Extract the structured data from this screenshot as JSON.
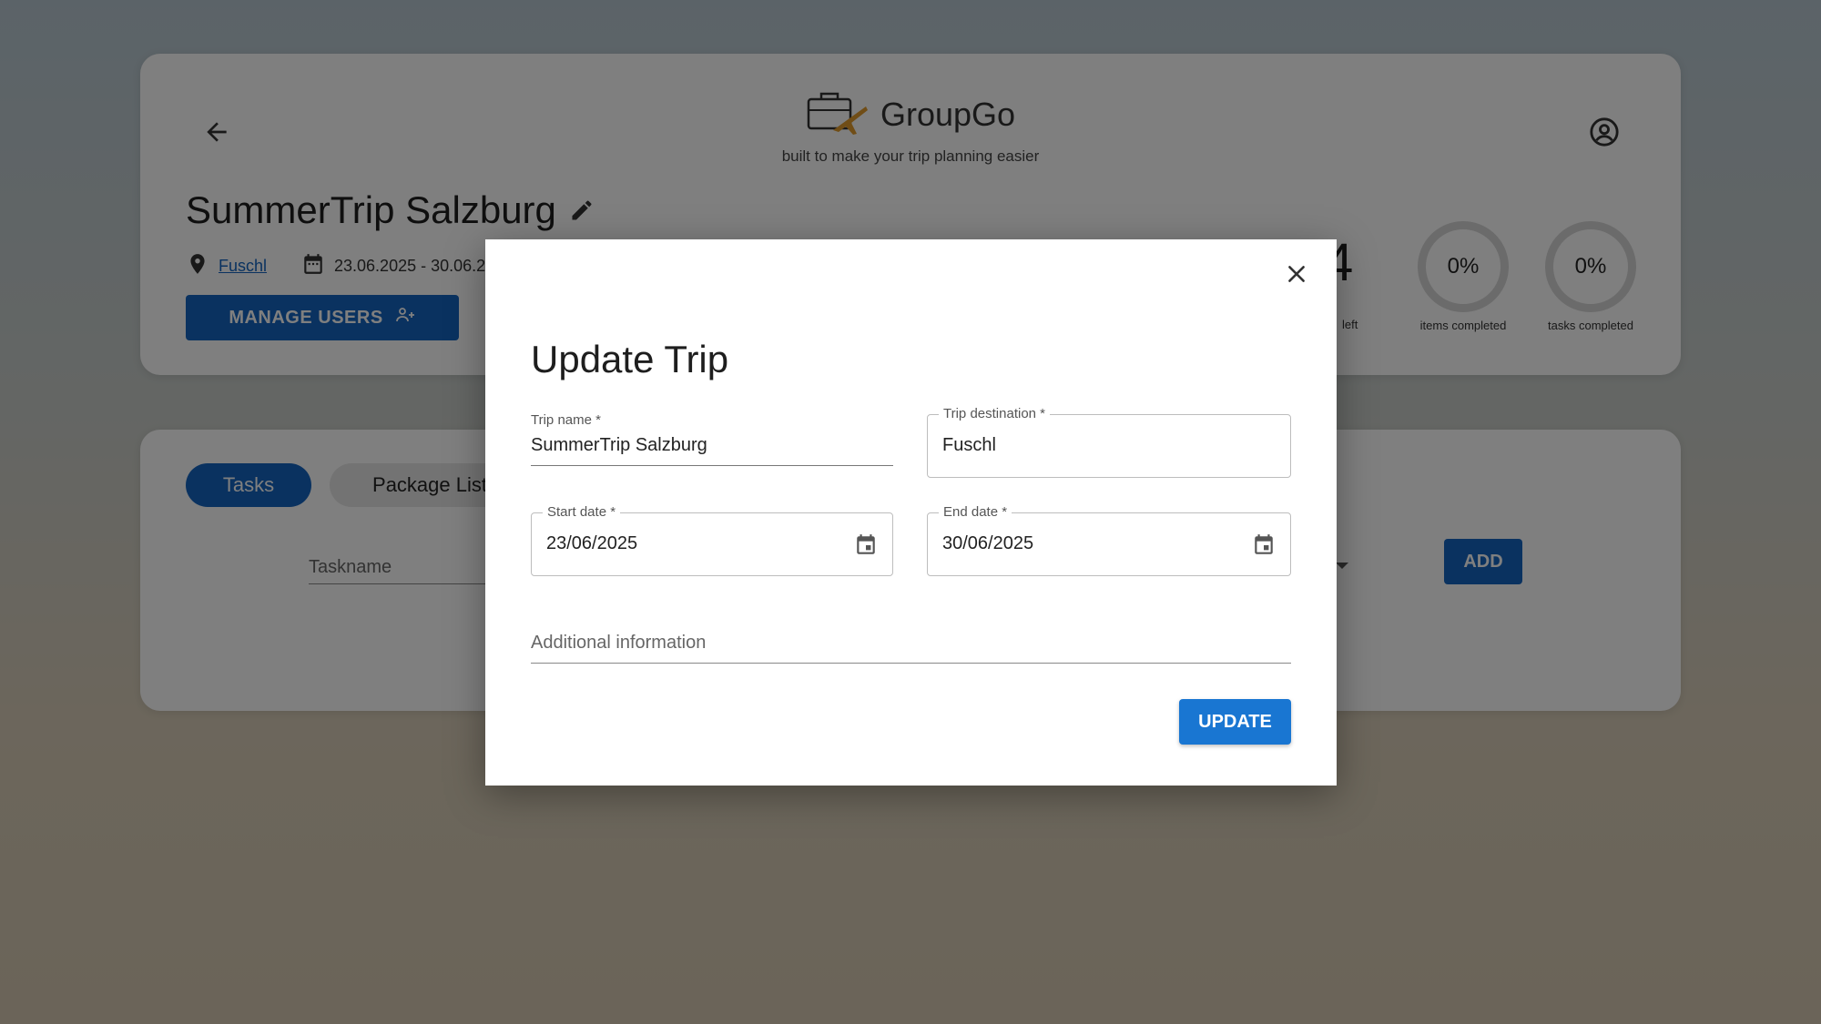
{
  "brand": {
    "name": "GroupGo",
    "tagline": "built to make your trip planning easier"
  },
  "trip": {
    "title": "SummerTrip Salzburg",
    "location": "Fuschl",
    "dates": "23.06.2025 - 30.06.2",
    "manage_users_label": "MANAGE USERS"
  },
  "stats": {
    "days_value": "4",
    "days_label": "left",
    "items_percent": "0%",
    "items_label": "items completed",
    "tasks_percent": "0%",
    "tasks_label": "tasks completed"
  },
  "tabs": [
    {
      "label": "Tasks",
      "active": true
    },
    {
      "label": "Package List",
      "active": false
    }
  ],
  "task_form": {
    "taskname_placeholder": "Taskname",
    "add_label": "ADD"
  },
  "dialog": {
    "title": "Update Trip",
    "trip_name_label": "Trip name *",
    "trip_name_value": "SummerTrip Salzburg",
    "destination_label": "Trip destination *",
    "destination_value": "Fuschl",
    "start_label": "Start date *",
    "start_value": "23/06/2025",
    "end_label": "End date *",
    "end_value": "30/06/2025",
    "additional_placeholder": "Additional information",
    "update_label": "UPDATE"
  },
  "colors": {
    "primary": "#1565c0",
    "button": "#1976d2"
  }
}
